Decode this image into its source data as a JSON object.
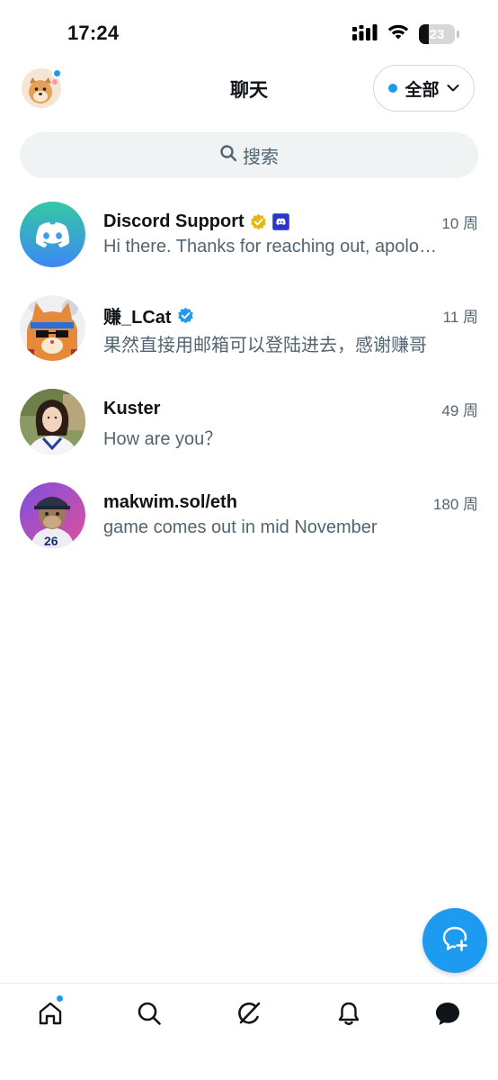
{
  "status_bar": {
    "time": "17:24",
    "battery_level": "23",
    "icons": [
      "cellular-signal-icon",
      "wifi-icon",
      "battery-icon"
    ]
  },
  "header": {
    "title": "聊天",
    "filter_label": "全部"
  },
  "search": {
    "placeholder": "搜索"
  },
  "conversations": [
    {
      "name": "Discord Support",
      "time": "10 周",
      "message": "Hi there. Thanks for reaching out, apologies for the delay",
      "badges": [
        "gold-verified-icon",
        "discord-affiliate-icon"
      ]
    },
    {
      "name": "赚_LCat",
      "time": "11 周",
      "message": "果然直接用邮箱可以登陆进去，感谢赚哥",
      "badges": [
        "blue-verified-icon"
      ]
    },
    {
      "name": "Kuster",
      "time": "49 周",
      "message": "How are you？",
      "badges": []
    },
    {
      "name": "makwim.sol/eth",
      "time": "180 周",
      "message": "game comes out in mid November",
      "badges": []
    }
  ],
  "tabs": [
    "home-icon",
    "search-icon",
    "grok-icon",
    "notifications-icon",
    "messages-icon"
  ],
  "colors": {
    "accent": "#1d9bf0",
    "text_primary": "#0f1419",
    "text_secondary": "#536471",
    "search_bg": "#eff3f4"
  }
}
